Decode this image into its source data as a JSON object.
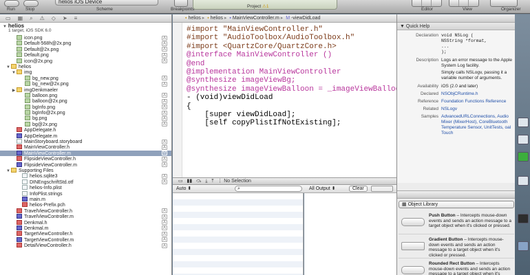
{
  "toolbar": {
    "run_label": "Run",
    "stop_label": "Stop",
    "scheme_label": "Scheme",
    "scheme_value": "helios   iOS Device",
    "breakpoints_label": "Breakpoints",
    "activity_project": "Project",
    "activity_warning": "1",
    "editor_label": "Editor",
    "view_label": "View",
    "organizer_label": "Organizer"
  },
  "project": {
    "name": "helios",
    "subtitle": "1 target, iOS SDK 6.0"
  },
  "tree": [
    {
      "label": "icon.png",
      "badge": "A"
    },
    {
      "label": "Default-568h@2x.png",
      "badge": "A"
    },
    {
      "label": "Default@2x.png",
      "badge": "A"
    },
    {
      "label": "Default.png",
      "badge": "A"
    },
    {
      "label": "icon@2x.png",
      "badge": "A"
    },
    {
      "label": "helios",
      "badge": ""
    },
    {
      "label": "img",
      "badge": ""
    },
    {
      "label": "bg_new.png",
      "badge": "A"
    },
    {
      "label": "bg_new@2x.png",
      "badge": "A"
    },
    {
      "label": "imgDenkmaeler",
      "badge": ""
    },
    {
      "label": "balloon.png",
      "badge": "A"
    },
    {
      "label": "balloon@2x.png",
      "badge": "A"
    },
    {
      "label": "bgInfo.png",
      "badge": "A"
    },
    {
      "label": "bgInfo@2x.png",
      "badge": "A"
    },
    {
      "label": "bg.png",
      "badge": "A"
    },
    {
      "label": "bg@2x.png",
      "badge": "A"
    },
    {
      "label": "AppDelegate.h",
      "badge": ""
    },
    {
      "label": "AppDelegate.m",
      "badge": ""
    },
    {
      "label": "MainStoryboard.storyboard",
      "badge": "A"
    },
    {
      "label": "MainViewController.h",
      "badge": "A"
    },
    {
      "label": "MainViewController.m",
      "badge": "M"
    },
    {
      "label": "FlipsideViewController.h",
      "badge": "A"
    },
    {
      "label": "FlipsideViewController.m",
      "badge": "A"
    },
    {
      "label": "Supporting Files",
      "badge": ""
    },
    {
      "label": "helios.sqlite3",
      "badge": "A"
    },
    {
      "label": "DINEngschriftStd.otf",
      "badge": "A"
    },
    {
      "label": "helios-Info.plist",
      "badge": ""
    },
    {
      "label": "InfoPlist.strings",
      "badge": ""
    },
    {
      "label": "main.m",
      "badge": ""
    },
    {
      "label": "helios-Prefix.pch",
      "badge": ""
    },
    {
      "label": "TravelViewController.h",
      "badge": "A"
    },
    {
      "label": "TravelViewController.m",
      "badge": "A"
    },
    {
      "label": "Denkmal.h",
      "badge": "A"
    },
    {
      "label": "Denkmal.m",
      "badge": "A"
    },
    {
      "label": "TargetViewController.h",
      "badge": "A"
    },
    {
      "label": "TargetViewController.m",
      "badge": "A"
    },
    {
      "label": "DetailViewController.h",
      "badge": "A"
    }
  ],
  "jumpbar": [
    "helios",
    "helios",
    "MainViewController.m",
    "-viewDidLoad"
  ],
  "code": [
    "#import \"MainViewController.h\"",
    "#import \"AudioToolbox/AudioToolbox.h\"",
    "#import <QuartzCore/QuartzCore.h>",
    "",
    "",
    "@interface MainViewController ()",
    "",
    "@end",
    "",
    "",
    "@implementation MainViewController",
    "",
    "@synthesize imageViewBg;",
    "@synthesize imageViewBalloon = _imageViewBalloon;",
    "",
    "- (void)viewDidLoad",
    "{",
    "    [super viewDidLoad];",
    "    [self copyPlistIfNotExisting];"
  ],
  "debug": {
    "no_selection": "No Selection",
    "auto_label": "Auto",
    "all_output_label": "All Output",
    "clear_label": "Clear"
  },
  "quick_help": {
    "header": "Quick Help",
    "declaration_key": "Declaration",
    "declaration_lines": [
      "void NSLog (",
      "    NSString *format,",
      "    ...",
      ");"
    ],
    "description_key": "Description",
    "description_1": "Logs an error message to the Apple System Log facility.",
    "description_2": "Simply calls NSLogv, passing it a variable number of arguments.",
    "availability_key": "Availability",
    "availability": "iOS (2.0 and later)",
    "declared_key": "Declared",
    "declared": "NSObjCRuntime.h",
    "reference_key": "Reference",
    "reference": "Foundation Functions Reference",
    "related_key": "Related",
    "related": "NSLogv",
    "samples_key": "Samples",
    "samples": "AdvancedURLConnections, Audio Mixer (MixerHost), CoreBluetooth Temperature Sensor, UnitTests, oal Touch"
  },
  "library": {
    "select": "Object Library",
    "items": [
      {
        "title": "Push Button",
        "text": " – Intercepts mouse-down events and sends an action message to a target object when it's clicked or pressed."
      },
      {
        "title": "Gradient Button",
        "text": " – Intercepts mouse-down events and sends an action message to a target object when it's clicked or pressed."
      },
      {
        "title": "Rounded Rect Button",
        "text": " – Intercepts mouse-down events and sends an action message to a target object when it's clicked or pressed."
      }
    ]
  }
}
